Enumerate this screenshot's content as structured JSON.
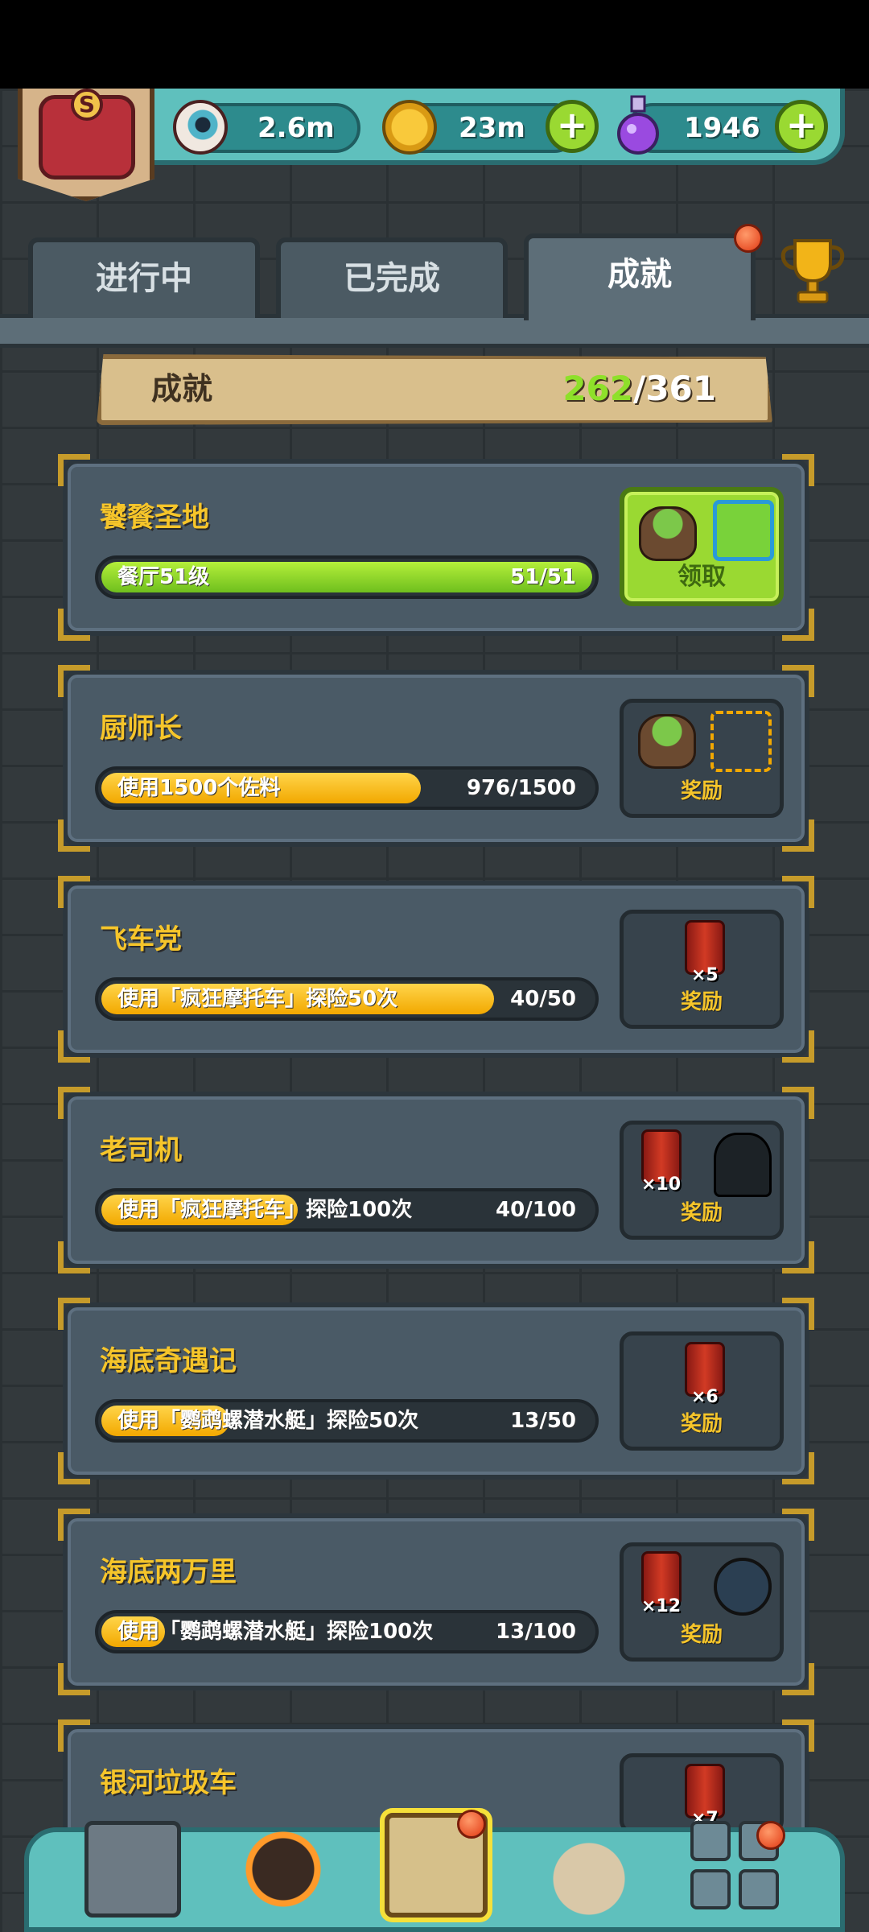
{
  "resources": {
    "eyes": "2.6m",
    "coins": "23m",
    "potions": "1946"
  },
  "tabs": [
    {
      "label": "进行中",
      "active": false
    },
    {
      "label": "已完成",
      "active": false
    },
    {
      "label": "成就",
      "active": true,
      "notification": true
    }
  ],
  "achievements_header": {
    "title": "成就",
    "completed": "262",
    "total": "/361"
  },
  "cards": [
    {
      "title": "饕餮圣地",
      "task": "餐厅51级",
      "progress_text": "51/51",
      "progress": 1.0,
      "bar_color": "green",
      "reward_label": "领取",
      "claimable": true,
      "rewards": [
        "rock-icon",
        "empty-slot"
      ]
    },
    {
      "title": "厨师长",
      "task": "使用1500个佐料",
      "progress_text": "976/1500",
      "progress": 0.65,
      "bar_color": "yellow",
      "reward_label": "奖励",
      "claimable": false,
      "rewards": [
        "rock-icon",
        "empty-slot"
      ]
    },
    {
      "title": "飞车党",
      "task": "使用「疯狂摩托车」探险50次",
      "progress_text": "40/50",
      "progress": 0.8,
      "bar_color": "yellow",
      "reward_label": "奖励",
      "claimable": false,
      "rewards": [
        "barrel-icon"
      ],
      "barrel_count": "×5"
    },
    {
      "title": "老司机",
      "task": "使用「疯狂摩托车」探险100次",
      "progress_text": "40/100",
      "progress": 0.4,
      "bar_color": "yellow",
      "reward_label": "奖励",
      "claimable": false,
      "rewards": [
        "barrel-icon",
        "ghost-icon"
      ],
      "barrel_count": "×10"
    },
    {
      "title": "海底奇遇记",
      "task": "使用「鹦鹉螺潜水艇」探险50次",
      "progress_text": "13/50",
      "progress": 0.26,
      "bar_color": "yellow",
      "reward_label": "奖励",
      "claimable": false,
      "rewards": [
        "barrel-icon"
      ],
      "barrel_count": "×6"
    },
    {
      "title": "海底两万里",
      "task": "使用「鹦鹉螺潜水艇」探险100次",
      "progress_text": "13/100",
      "progress": 0.13,
      "bar_color": "yellow",
      "reward_label": "奖励",
      "claimable": false,
      "rewards": [
        "barrel-icon",
        "robot-icon"
      ],
      "barrel_count": "×12"
    },
    {
      "title": "银河垃圾车",
      "barrel_count": "×7"
    }
  ],
  "bottom_nav": [
    {
      "name": "shop-icon"
    },
    {
      "name": "monster-icon"
    },
    {
      "name": "book-icon",
      "active": true,
      "notification": true
    },
    {
      "name": "bag-icon"
    },
    {
      "name": "grid-icon",
      "notification": true
    }
  ]
}
